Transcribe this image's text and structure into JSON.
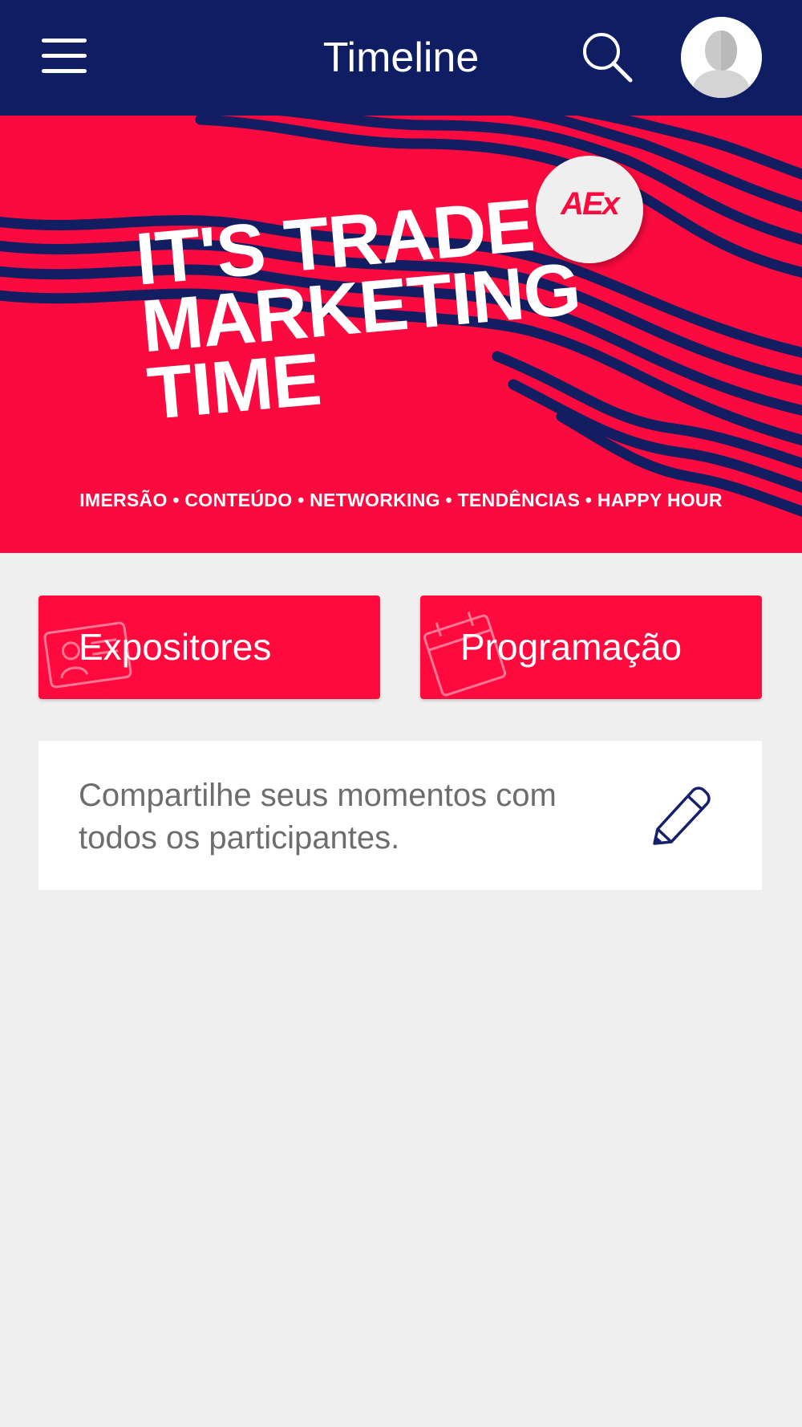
{
  "header": {
    "title": "Timeline",
    "background": "#0f1d63"
  },
  "banner": {
    "headline": [
      "IT'S TRADE",
      "MARKETING",
      "TIME"
    ],
    "tagline": "IMERSÃO • CONTEÚDO • NETWORKING • TENDÊNCIAS • HAPPY HOUR",
    "sticker_text": "AEx",
    "background": "#fb0a3f",
    "stripe_color": "#131d62"
  },
  "actions": {
    "exhibitors_label": "Expositores",
    "schedule_label": "Programação",
    "color": "#ff0a3e"
  },
  "share": {
    "prompt": "Compartilhe seus momentos com todos os participantes.",
    "icon": "pencil-icon"
  },
  "icons": {
    "menu": "menu-icon",
    "search": "search-icon",
    "avatar": "user-avatar-icon"
  }
}
